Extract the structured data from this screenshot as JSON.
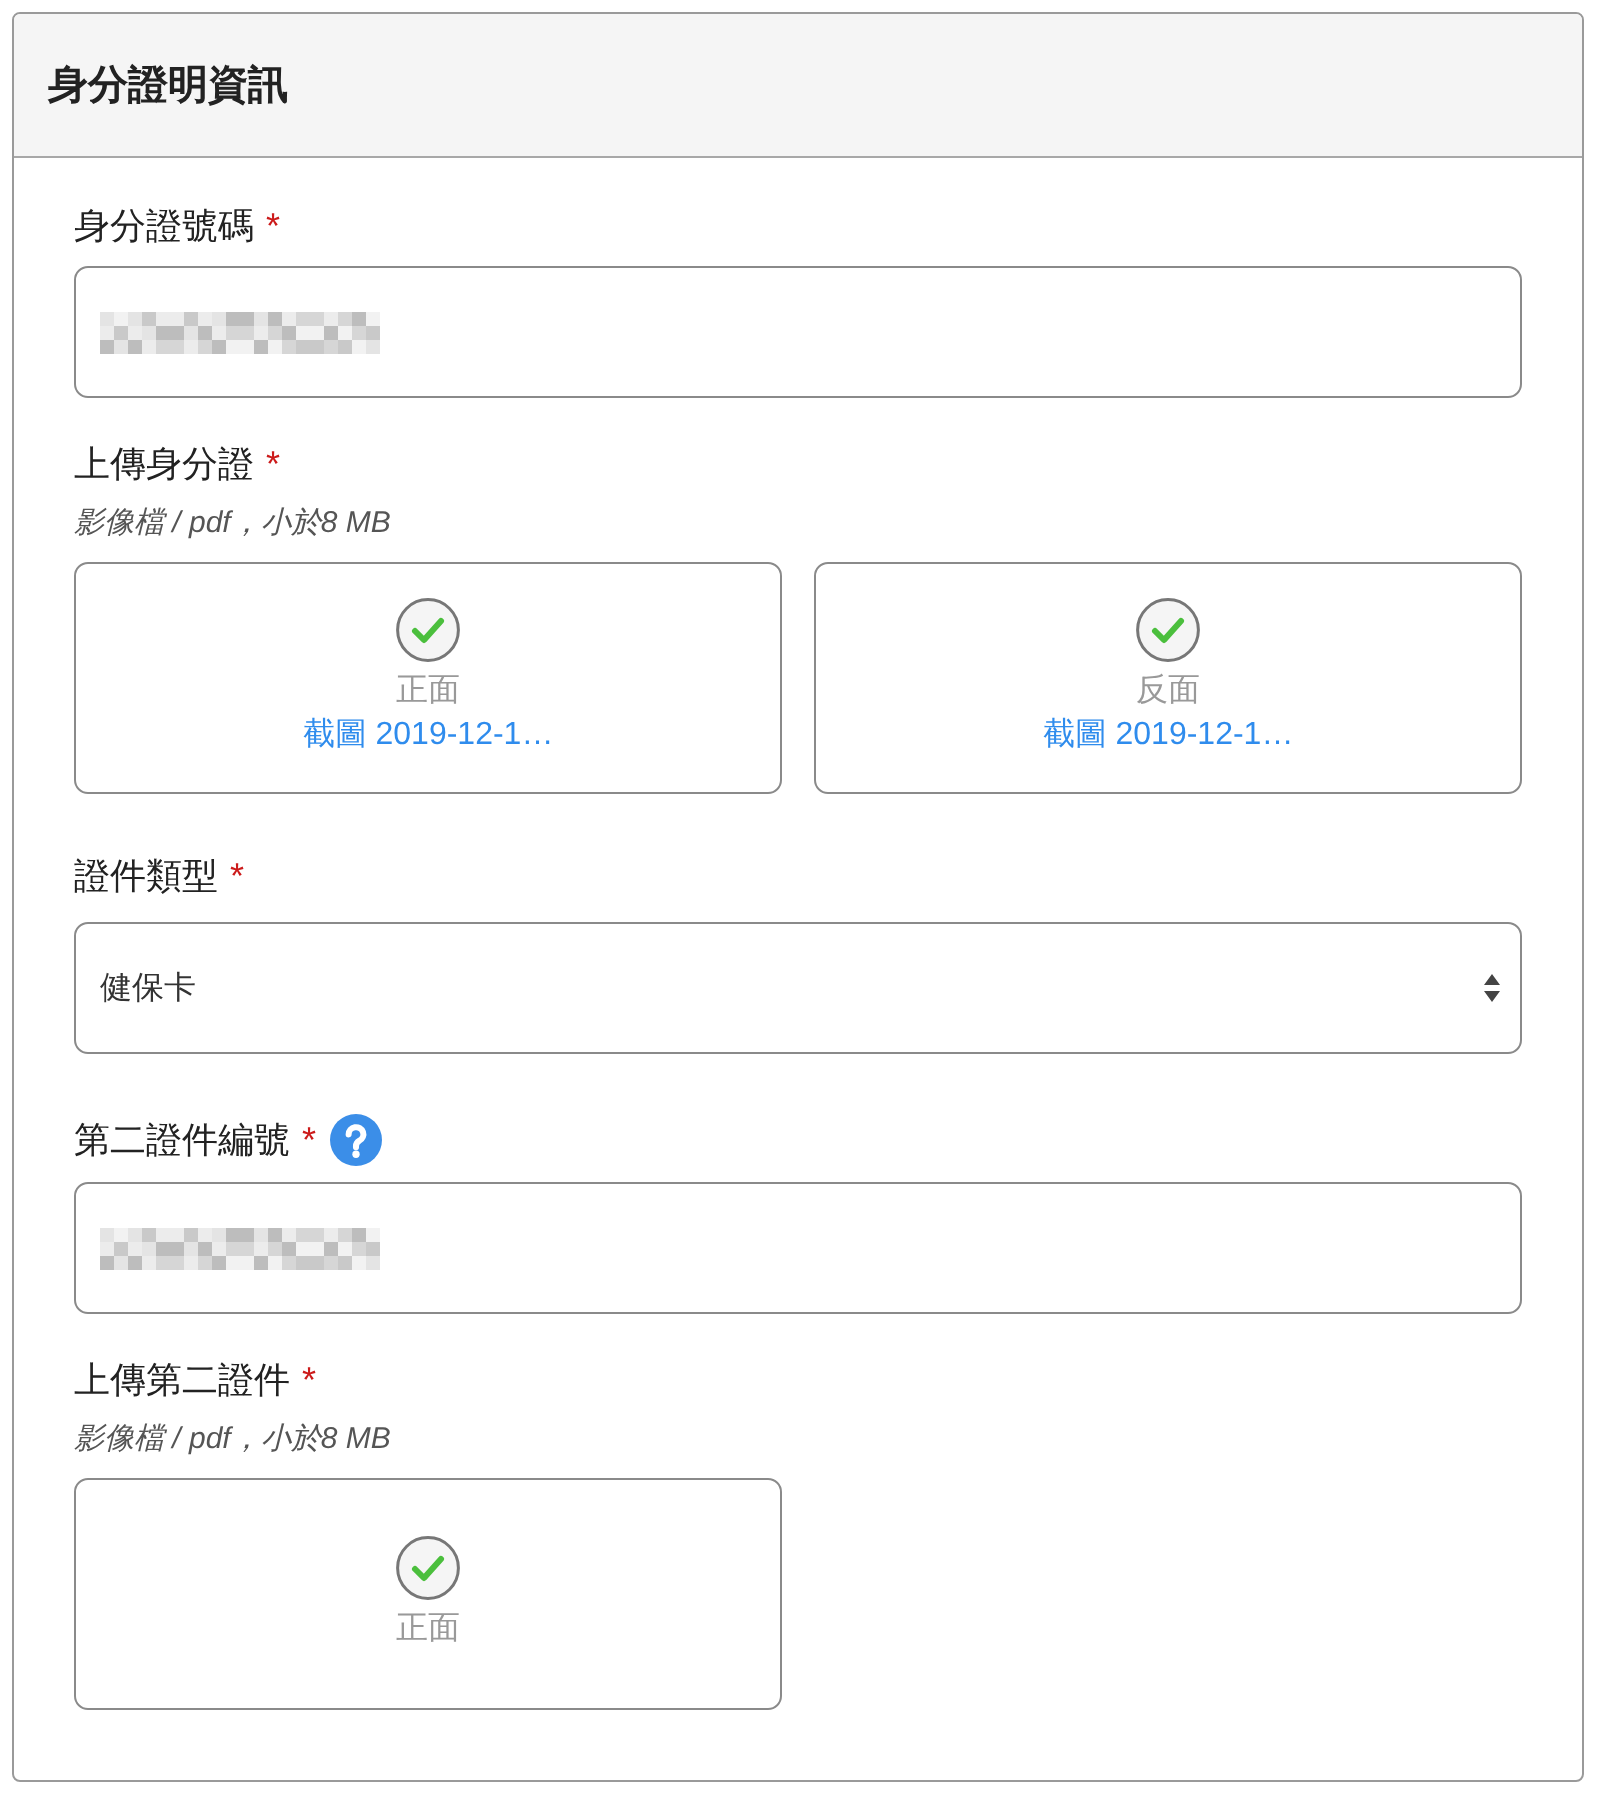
{
  "panel": {
    "title": "身分證明資訊"
  },
  "fields": [
    {
      "kind": "text",
      "label": "身分證號碼",
      "required_mark": "*",
      "redacted": true
    },
    {
      "kind": "upload",
      "label": "上傳身分證",
      "required_mark": "*",
      "hint": "影像檔 / pdf，小於8 MB",
      "slots": [
        {
          "side": "正面",
          "uploaded": true,
          "file": "截圖 2019-12-1…"
        },
        {
          "side": "反面",
          "uploaded": true,
          "file": "截圖 2019-12-1…"
        }
      ]
    },
    {
      "kind": "select",
      "label": "證件類型",
      "required_mark": "*",
      "value": "健保卡"
    },
    {
      "kind": "text",
      "label": "第二證件編號",
      "required_mark": "*",
      "help": true,
      "redacted": true
    },
    {
      "kind": "upload",
      "label": "上傳第二證件",
      "required_mark": "*",
      "hint": "影像檔 / pdf，小於8 MB",
      "slots": [
        {
          "side": "正面",
          "uploaded": true
        }
      ]
    }
  ]
}
